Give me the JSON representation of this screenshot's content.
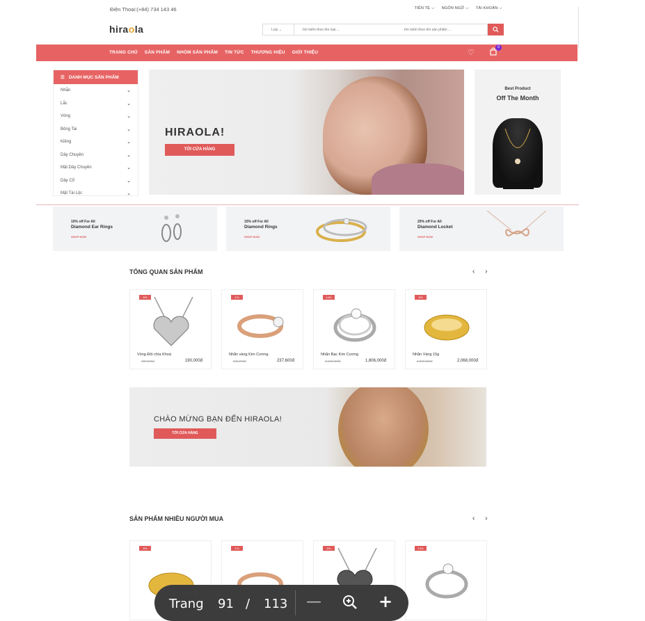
{
  "topbar": {
    "phone": "Điện Thoại:(+84) 734 143 46",
    "currency": "TIỀN TỆ",
    "language": "NGÔN NGỮ",
    "account": "TÀI KHOẢN"
  },
  "header": {
    "logo_left": "hira",
    "logo_o": "o",
    "logo_right": "la",
    "search": {
      "category": "Loại",
      "placeholder_type": "tìm kiếm theo tên loại ...",
      "placeholder_product": "tìm kiếm theo tên sản phẩm ..."
    },
    "search_icon": "search-icon"
  },
  "nav": {
    "items": [
      "TRANG CHỦ",
      "SẢN PHẨM",
      "NHÓM SẢN PHẨM",
      "TIN TỨC",
      "THƯƠNG HIỆU",
      "GIỚI THIỆU"
    ],
    "cart_count": "0"
  },
  "categories": {
    "title": "DANH MỤC SẢN PHẨM",
    "items": [
      "Nhẫn",
      "Lắc",
      "Vòng",
      "Bông Tai",
      "Kiềng",
      "Dây Chuyền",
      "Mặt Dây Chuyền",
      "Dây Cổ",
      "Mặt Tài Lộc"
    ]
  },
  "hero": {
    "title": "HIRAOLA!",
    "cta": "TỚI CỬA HÀNG"
  },
  "best": {
    "line1": "Best Product",
    "line2": "Off The Month"
  },
  "promos": [
    {
      "off": "10% off For All",
      "name": "Diamond Ear Rings",
      "link": "SHOP NOW"
    },
    {
      "off": "15% off For All",
      "name": "Diamond Rings",
      "link": "SHOP NOW"
    },
    {
      "off": "20% off For All",
      "name": "Diamond Locket",
      "link": "SHOP NOW"
    }
  ],
  "overview": {
    "title": "TỔNG QUAN SẢN PHẨM",
    "arrows": "‹ ›",
    "products": [
      {
        "tag": "5%",
        "name": "Vòng Đôi chìa Khoá",
        "old": "200,000đ",
        "price": "190,000đ"
      },
      {
        "tag": "1%",
        "name": "Nhẫn vàng Kim Cương",
        "old": "240,000đ",
        "price": "237,600đ"
      },
      {
        "tag": "14%",
        "name": "Nhẫn Bạc Kim Cương",
        "old": "2,100,000đ",
        "price": "1,806,000đ"
      },
      {
        "tag": "6%",
        "name": "Nhẫn Vàng 15g",
        "old": "2,200,000đ",
        "price": "2,068,000đ"
      }
    ]
  },
  "welcome": {
    "title": "CHÀO MỪNG BẠN ĐẾN HIRAOLA!",
    "cta": "TỚI CỬA HÀNG"
  },
  "bestsellers": {
    "title": "SẢN PHẨM NHIỀU NGƯỜI MUA",
    "arrows": "‹ ›",
    "tags": [
      "6%",
      "1%",
      "5%",
      "14%"
    ]
  },
  "pager": {
    "label": "Trang",
    "current": "91",
    "separator": "/",
    "total": "113"
  }
}
